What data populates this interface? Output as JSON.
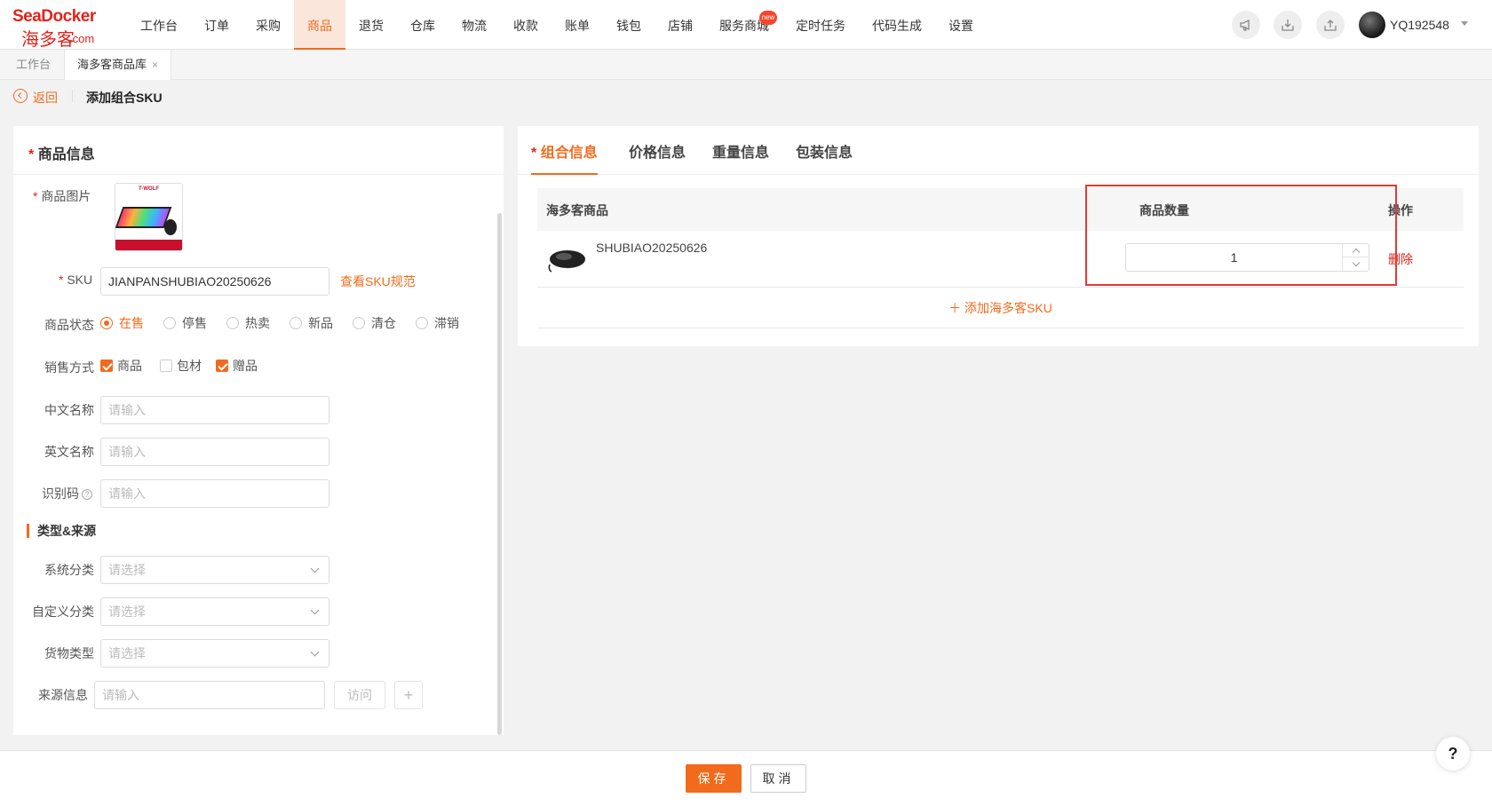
{
  "logo": {
    "brand": "SeaDocker",
    "cn": "海多客",
    "domain": ".com"
  },
  "nav": {
    "items": [
      {
        "label": "工作台"
      },
      {
        "label": "订单"
      },
      {
        "label": "采购"
      },
      {
        "label": "商品"
      },
      {
        "label": "退货"
      },
      {
        "label": "仓库"
      },
      {
        "label": "物流"
      },
      {
        "label": "收款"
      },
      {
        "label": "账单"
      },
      {
        "label": "钱包"
      },
      {
        "label": "店铺"
      },
      {
        "label": "服务商城"
      },
      {
        "label": "定时任务"
      },
      {
        "label": "代码生成"
      },
      {
        "label": "设置"
      }
    ],
    "active": "商品",
    "badge": "new"
  },
  "user": {
    "name": "YQ192548"
  },
  "page_tabs": [
    {
      "label": "工作台"
    },
    {
      "label": "海多客商品库",
      "close": "×"
    }
  ],
  "breadcrumb": {
    "back": "返回",
    "title": "添加组合SKU"
  },
  "left": {
    "section_title": "商品信息",
    "req": "*",
    "image_label": "商品图片",
    "thumb_brand": "T-WOLF",
    "sku_label": "SKU",
    "sku_value": "JIANPANSHUBIAO20250626",
    "sku_link": "查看SKU规范",
    "status_label": "商品状态",
    "status_options": [
      "在售",
      "停售",
      "热卖",
      "新品",
      "清仓",
      "滞销"
    ],
    "sale_label": "销售方式",
    "sale_options": [
      "商品",
      "包材",
      "赠品"
    ],
    "cn_name_label": "中文名称",
    "en_name_label": "英文名称",
    "id_code_label": "识别码",
    "placeholder_input": "请输入",
    "placeholder_select": "请选择",
    "type_section": "类型&来源",
    "sys_cat_label": "系统分类",
    "custom_cat_label": "自定义分类",
    "goods_type_label": "货物类型",
    "source_label": "来源信息",
    "visit_btn": "访问",
    "plus": "+"
  },
  "right": {
    "tabs": [
      {
        "label": "组合信息",
        "req": "*"
      },
      {
        "label": "价格信息"
      },
      {
        "label": "重量信息"
      },
      {
        "label": "包装信息"
      }
    ],
    "columns": [
      "海多客商品",
      "商品数量",
      "操作"
    ],
    "rows": [
      {
        "sku": "SHUBIAO20250626",
        "qty": "1",
        "action": "删除"
      }
    ],
    "add_sku": "＋ 添加海多客SKU"
  },
  "footer": {
    "save": "保存",
    "cancel": "取消"
  },
  "help": "?"
}
